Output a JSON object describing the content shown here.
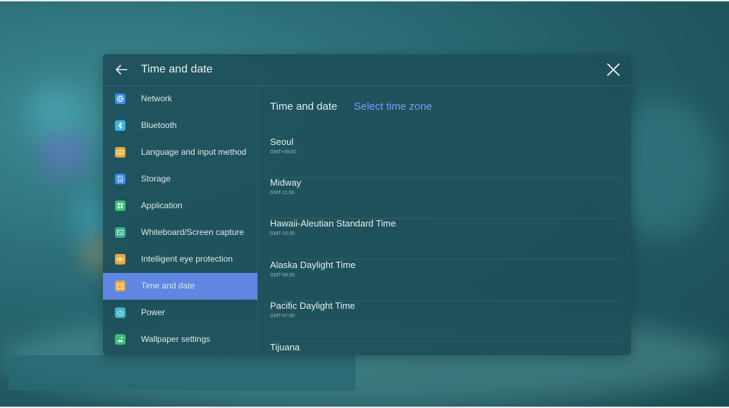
{
  "header": {
    "title": "Time and date"
  },
  "sidebar": {
    "items": [
      {
        "label": "Network",
        "icon": "globe-icon",
        "color": "#3d8ef0"
      },
      {
        "label": "Bluetooth",
        "icon": "bluetooth-icon",
        "color": "#3fb2e0"
      },
      {
        "label": "Language and input method",
        "icon": "keyboard-icon",
        "color": "#e6a93a"
      },
      {
        "label": "Storage",
        "icon": "storage-icon",
        "color": "#3d8ef0"
      },
      {
        "label": "Application",
        "icon": "apps-grid-icon",
        "color": "#38c07a"
      },
      {
        "label": "Whiteboard/Screen capture",
        "icon": "screen-capture-icon",
        "color": "#38b38a"
      },
      {
        "label": "Intelligent eye protection",
        "icon": "eye-icon",
        "color": "#e6a93a"
      },
      {
        "label": "Time and date",
        "icon": "calendar-icon",
        "color": "#e6a93a",
        "active": true
      },
      {
        "label": "Power",
        "icon": "power-icon",
        "color": "#3fb8c8"
      },
      {
        "label": "Wallpaper settings",
        "icon": "wallpaper-icon",
        "color": "#38c07a"
      }
    ]
  },
  "content": {
    "title": "Time and date",
    "link": "Select time zone",
    "zones": [
      {
        "name": "Seoul",
        "offset": "GMT+09:00"
      },
      {
        "name": "Midway",
        "offset": "GMT-11:00"
      },
      {
        "name": "Hawaii-Aleutian Standard Time",
        "offset": "GMT-10:00"
      },
      {
        "name": "Alaska Daylight Time",
        "offset": "GMT-08:00"
      },
      {
        "name": "Pacific Daylight Time",
        "offset": "GMT-07:00"
      },
      {
        "name": "Tijuana",
        "offset": ""
      }
    ]
  },
  "colors": {
    "accent": "#5f86e0",
    "link": "#6fa0ff"
  }
}
